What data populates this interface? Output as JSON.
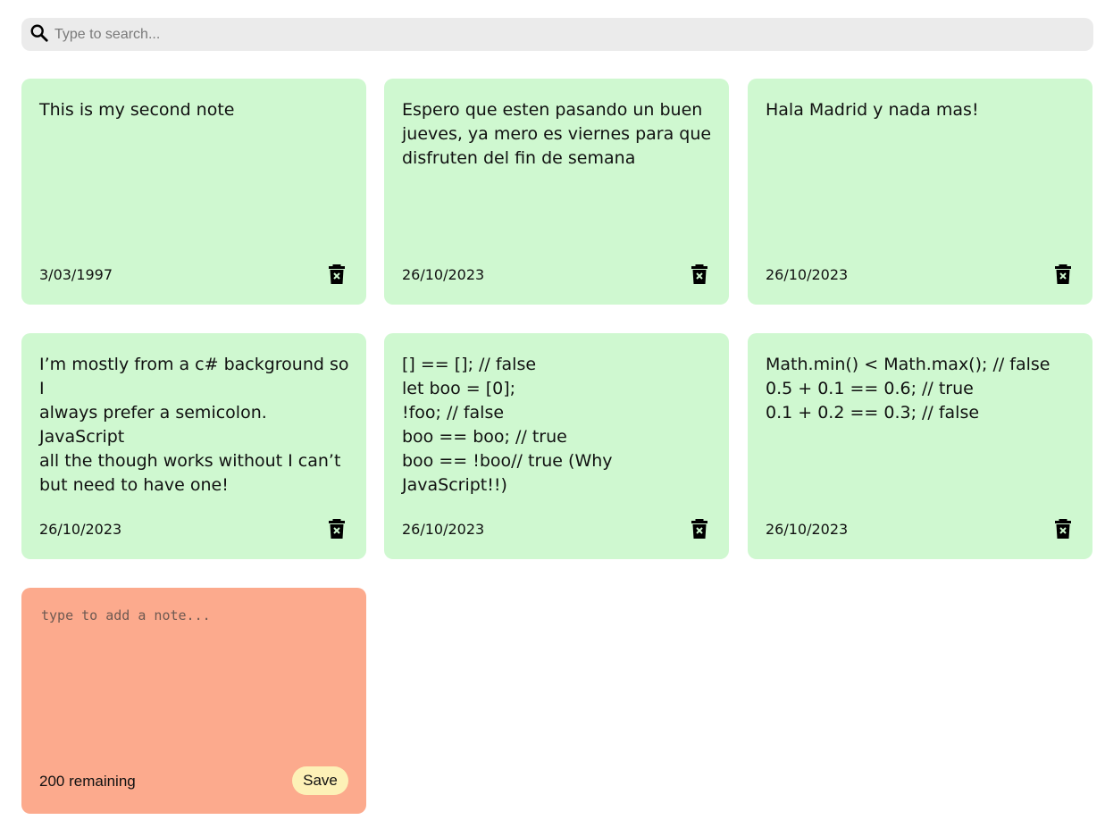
{
  "search": {
    "placeholder": "Type to search...",
    "icon": "search-icon"
  },
  "notes": [
    {
      "text": "This is my second note",
      "date": "3/03/1997"
    },
    {
      "text": "Espero que esten pasando un buen\njueves, ya mero es viernes para que\ndisfruten del fin de semana",
      "date": "26/10/2023"
    },
    {
      "text": "Hala Madrid y nada mas!",
      "date": "26/10/2023"
    },
    {
      "text": "I’m mostly from a c# background so I\nalways prefer a semicolon. JavaScript\nall the though works without I can’t\nbut need to have one!",
      "date": "26/10/2023"
    },
    {
      "text": "[] == []; // false\nlet boo = [0];\n!foo; // false\nboo == boo; // true\nboo == !boo// true (Why JavaScript!!)",
      "date": "26/10/2023"
    },
    {
      "text": "Math.min() < Math.max(); // false\n0.5 + 0.1 == 0.6; // true\n0.1 + 0.2 == 0.3; // false",
      "date": "26/10/2023"
    }
  ],
  "new_note": {
    "placeholder": "type to add a note...",
    "remaining": "200 remaining",
    "save_label": "Save"
  },
  "colors": {
    "note_bg": "#cff8d0",
    "new_note_bg": "#fcaa8d",
    "save_bg": "#fdf1b7",
    "search_bg": "#ebebeb"
  },
  "icons": {
    "delete": "trash-x-icon"
  }
}
